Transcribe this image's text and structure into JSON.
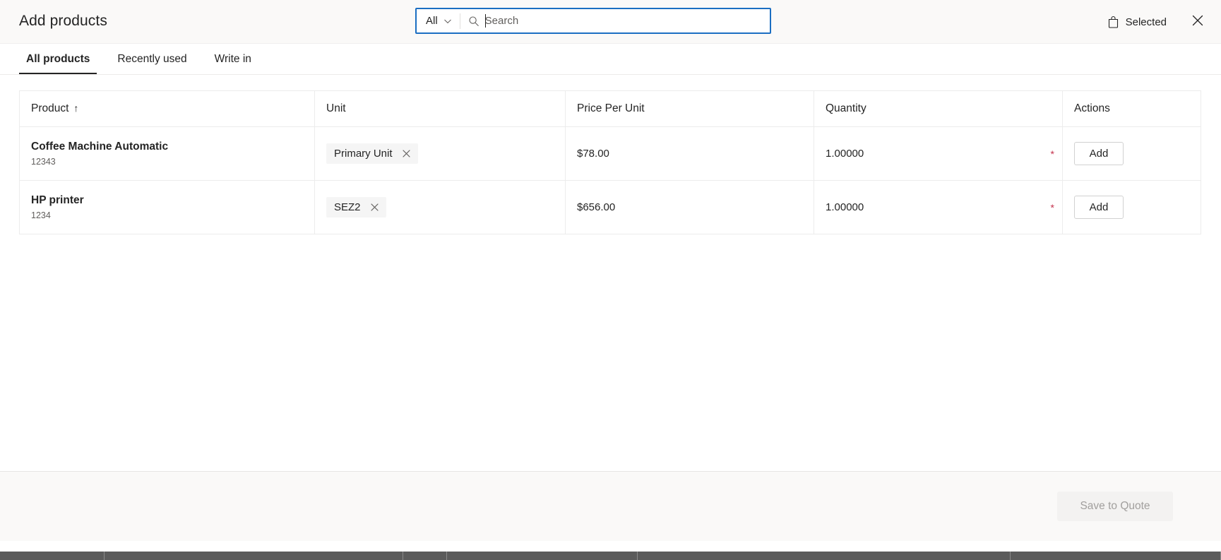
{
  "header": {
    "title": "Add products",
    "search": {
      "scope_label": "All",
      "scope_icon": "chevron-down-icon",
      "icon": "search-icon",
      "placeholder": "Search",
      "value": ""
    },
    "selected_label": "Selected",
    "selected_icon": "shopping-bag-icon",
    "close_icon": "close-icon",
    "accent_focus_color": "#1b6ec2",
    "background_color": "#faf9f8"
  },
  "tabs": [
    {
      "label": "All products",
      "active": true
    },
    {
      "label": "Recently used",
      "active": false
    },
    {
      "label": "Write in",
      "active": false
    }
  ],
  "table": {
    "columns": [
      {
        "label": "Product",
        "sort_indicator": "↑"
      },
      {
        "label": "Unit",
        "sort_indicator": ""
      },
      {
        "label": "Price Per Unit",
        "sort_indicator": ""
      },
      {
        "label": "Quantity",
        "sort_indicator": ""
      },
      {
        "label": "Actions",
        "sort_indicator": ""
      }
    ],
    "rows": [
      {
        "product": "Coffee Machine Automatic",
        "product_id": "12343",
        "unit": "Primary Unit",
        "unit_remove_icon": "close-icon",
        "price_per_unit": "$78.00",
        "quantity": "1.00000",
        "quantity_required": "*",
        "action_label": "Add"
      },
      {
        "product": "HP printer",
        "product_id": "1234",
        "unit": "SEZ2",
        "unit_remove_icon": "close-icon",
        "price_per_unit": "$656.00",
        "quantity": "1.00000",
        "quantity_required": "*",
        "action_label": "Add"
      }
    ]
  },
  "footer": {
    "save_label": "Save to Quote",
    "save_enabled": false,
    "background_color": "#faf9f8"
  },
  "colors": {
    "required_asterisk": "#c4314b",
    "text_primary": "#242424",
    "text_secondary": "#605e5c",
    "border": "#ececec",
    "pill_background": "#f5f5f5"
  }
}
